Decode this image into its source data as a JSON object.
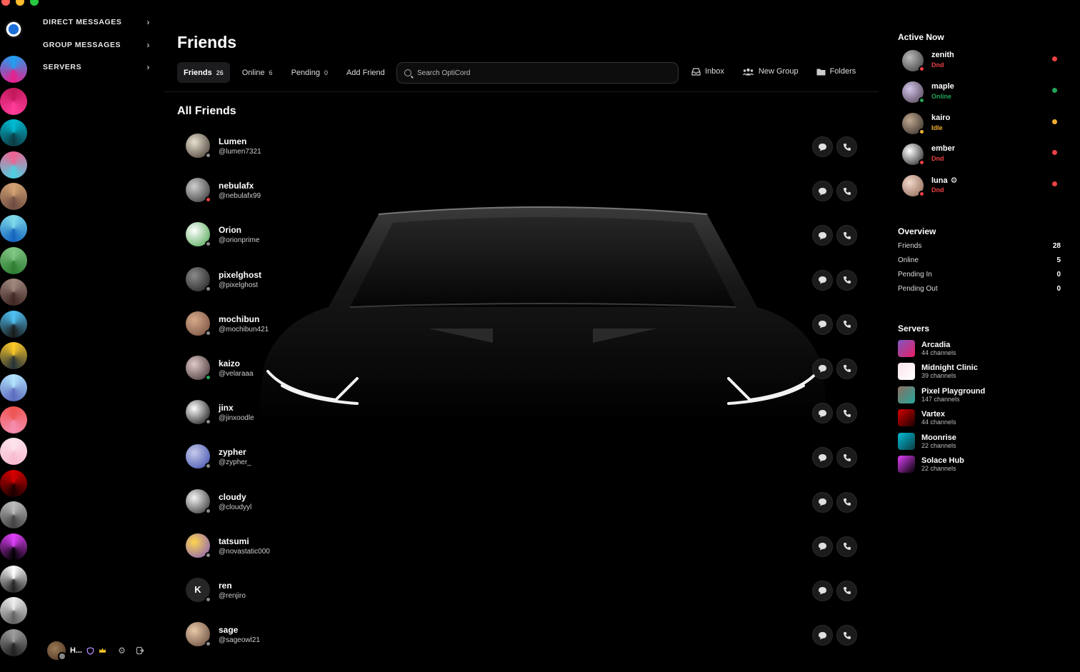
{
  "window": {
    "controls": [
      {
        "color": "#ff5f57"
      },
      {
        "color": "#febc2e"
      },
      {
        "color": "#28c840"
      }
    ]
  },
  "rail": {
    "items": [
      {
        "name": "home",
        "colors": [
          "#ffffff",
          "#1d6fd8"
        ]
      },
      {
        "name": "server-h",
        "colors": [
          "#1da1f2",
          "#e91e8c"
        ]
      },
      {
        "name": "server-red",
        "colors": [
          "#c2185b",
          "#ff3d9a"
        ]
      },
      {
        "name": "server-teal",
        "colors": [
          "#00bcd4",
          "#0d3b44"
        ]
      },
      {
        "name": "server-anime-pink",
        "colors": [
          "#f06292",
          "#4dd0e1"
        ]
      },
      {
        "name": "server-cat",
        "colors": [
          "#d4a373",
          "#6d4c41"
        ]
      },
      {
        "name": "server-ocean",
        "colors": [
          "#80deea",
          "#1565c0"
        ]
      },
      {
        "name": "server-green",
        "colors": [
          "#81c784",
          "#2e7d32"
        ]
      },
      {
        "name": "server-brown",
        "colors": [
          "#a1887f",
          "#3e2723"
        ]
      },
      {
        "name": "server-atom",
        "colors": [
          "#4fc3f7",
          "#1a1a1a"
        ]
      },
      {
        "name": "server-crown",
        "colors": [
          "#ffca28",
          "#263238"
        ]
      },
      {
        "name": "server-shell",
        "colors": [
          "#b3e5fc",
          "#5c6bc0"
        ]
      },
      {
        "name": "server-dots",
        "colors": [
          "#ef5350",
          "#f48fb1"
        ]
      },
      {
        "name": "server-pale",
        "colors": [
          "#fce4ec",
          "#f8bbd0"
        ]
      },
      {
        "name": "server-vartex",
        "colors": [
          "#d50000",
          "#1a0000"
        ]
      },
      {
        "name": "server-gray-c",
        "colors": [
          "#bdbdbd",
          "#424242"
        ]
      },
      {
        "name": "server-solace",
        "colors": [
          "#e040fb",
          "#000000"
        ]
      },
      {
        "name": "server-pattern",
        "colors": [
          "#ffffff",
          "#222222"
        ]
      },
      {
        "name": "server-ghost",
        "colors": [
          "#eeeeee",
          "#616161"
        ]
      },
      {
        "name": "server-dark",
        "colors": [
          "#9e9e9e",
          "#212121"
        ]
      }
    ]
  },
  "categories": [
    {
      "label": "DIRECT MESSAGES"
    },
    {
      "label": "GROUP MESSAGES"
    },
    {
      "label": "SERVERS"
    }
  ],
  "user": {
    "name": "H..."
  },
  "header": {
    "title": "Friends",
    "tabs": [
      {
        "label": "Friends",
        "count": "26",
        "active": true
      },
      {
        "label": "Online",
        "count": "6"
      },
      {
        "label": "Pending",
        "count": "0"
      },
      {
        "label": "Add Friend",
        "count": ""
      }
    ],
    "search_placeholder": "Search OptiCord",
    "actions": [
      {
        "label": "Inbox",
        "icon": "inbox-icon"
      },
      {
        "label": "New Group",
        "icon": "users-icon"
      },
      {
        "label": "Folders",
        "icon": "folder-icon"
      }
    ]
  },
  "friends_section_title": "All Friends",
  "friends": [
    {
      "name": "Lumen",
      "username": "@lumen7321",
      "status_color": "#8c8c8c",
      "avatar": [
        "#e8e0d0",
        "#3a3026"
      ]
    },
    {
      "name": "nebulafx",
      "username": "@nebulafx99",
      "status_color": "#ed4245",
      "avatar": [
        "#cfcfcf",
        "#2a2a2a"
      ]
    },
    {
      "name": "Orion",
      "username": "@orionprime",
      "status_color": "#8c8c8c",
      "avatar": [
        "#ffffff",
        "#43a047"
      ]
    },
    {
      "name": "pixelghost",
      "username": "@pixelghost",
      "status_color": "#8c8c8c",
      "avatar": [
        "#8a8a8a",
        "#1a1a1a"
      ]
    },
    {
      "name": "mochibun",
      "username": "@mochibun421",
      "status_color": "#8c8c8c",
      "avatar": [
        "#d7a98a",
        "#6d4a3a"
      ]
    },
    {
      "name": "kaizo",
      "username": "@velaraaa",
      "status_color": "#23a55a",
      "avatar": [
        "#e0c8c8",
        "#3a2a2a"
      ]
    },
    {
      "name": "jinx",
      "username": "@jinxoodle",
      "status_color": "#8c8c8c",
      "avatar": [
        "#ffffff",
        "#000000"
      ]
    },
    {
      "name": "zypher",
      "username": "@zypher_",
      "status_color": "#8c8c8c",
      "avatar": [
        "#c5cae9",
        "#3949ab"
      ]
    },
    {
      "name": "cloudy",
      "username": "@cloudyyl",
      "status_color": "#8c8c8c",
      "avatar": [
        "#f5f5f5",
        "#212121"
      ]
    },
    {
      "name": "tatsumi",
      "username": "@novastatic000",
      "status_color": "#8c8c8c",
      "avatar": [
        "#ffd54f",
        "#7e57c2"
      ]
    },
    {
      "name": "ren",
      "username": "@renjiro",
      "status_color": "#8c8c8c",
      "avatar": [
        "#262626",
        "#262626"
      ],
      "initial": "K"
    },
    {
      "name": "sage",
      "username": "@sageowl21",
      "status_color": "#8c8c8c",
      "avatar": [
        "#e8c9a8",
        "#5d4037"
      ]
    }
  ],
  "active_now": {
    "title": "Active Now",
    "items": [
      {
        "name": "zenith",
        "status": "Dnd",
        "color": "#ed4245",
        "avatar": [
          "#bbbbbb",
          "#333333"
        ]
      },
      {
        "name": "maple",
        "status": "Online",
        "color": "#23a55a",
        "avatar": [
          "#d1c4e9",
          "#4a3a4a"
        ]
      },
      {
        "name": "kairo",
        "status": "Idle",
        "color": "#f0b232",
        "avatar": [
          "#c0a890",
          "#2a2420"
        ]
      },
      {
        "name": "ember",
        "status": "Dnd",
        "color": "#ed4245",
        "avatar": [
          "#ffffff",
          "#111111"
        ]
      },
      {
        "name": "luna",
        "status": "Dnd",
        "color": "#ed4245",
        "avatar": [
          "#f0d8c8",
          "#8a6050"
        ],
        "badge": "⚙"
      }
    ]
  },
  "overview": {
    "title": "Overview",
    "rows": [
      {
        "label": "Friends",
        "value": "28"
      },
      {
        "label": "Online",
        "value": "5"
      },
      {
        "label": "Pending In",
        "value": "0"
      },
      {
        "label": "Pending Out",
        "value": "0"
      }
    ]
  },
  "servers": {
    "title": "Servers",
    "items": [
      {
        "name": "Arcadia",
        "channels": "44 channels",
        "colors": [
          "#7e57c2",
          "#e91e63"
        ]
      },
      {
        "name": "Midnight Clinic",
        "channels": "39 channels",
        "colors": [
          "#fce4ec",
          "#ffffff"
        ]
      },
      {
        "name": "Pixel Playground",
        "channels": "147 channels",
        "colors": [
          "#8d6e63",
          "#26a69a"
        ]
      },
      {
        "name": "Vartex",
        "channels": "44 channels",
        "colors": [
          "#d50000",
          "#1a0000"
        ]
      },
      {
        "name": "Moonrise",
        "channels": "22 channels",
        "colors": [
          "#00bcd4",
          "#0d3b44"
        ]
      },
      {
        "name": "Solace Hub",
        "channels": "22 channels",
        "colors": [
          "#e040fb",
          "#000000"
        ]
      }
    ]
  }
}
